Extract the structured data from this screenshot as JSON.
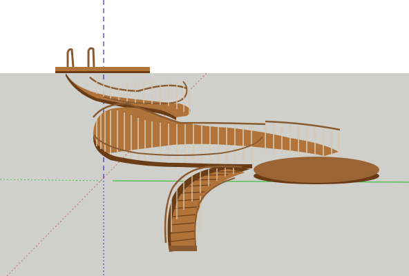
{
  "app": {
    "type": "3d-modeling-viewport"
  },
  "viewport": {
    "sky_color": "#ffffff",
    "ground_color": "#cfd0cb",
    "axes": {
      "red_color": "#d06060",
      "green_color": "#3cbf3c",
      "blue_color": "#3030c0"
    }
  },
  "model": {
    "name_icon": "spiral-staircase-model",
    "wood_top_color": "#b0743a",
    "wood_side_color": "#6b3d16",
    "rail_color": "#8a5a30",
    "baluster_color": "#d8c9b0",
    "platform_top_color": "#9a6435",
    "platform_side_color": "#6a3a14"
  }
}
